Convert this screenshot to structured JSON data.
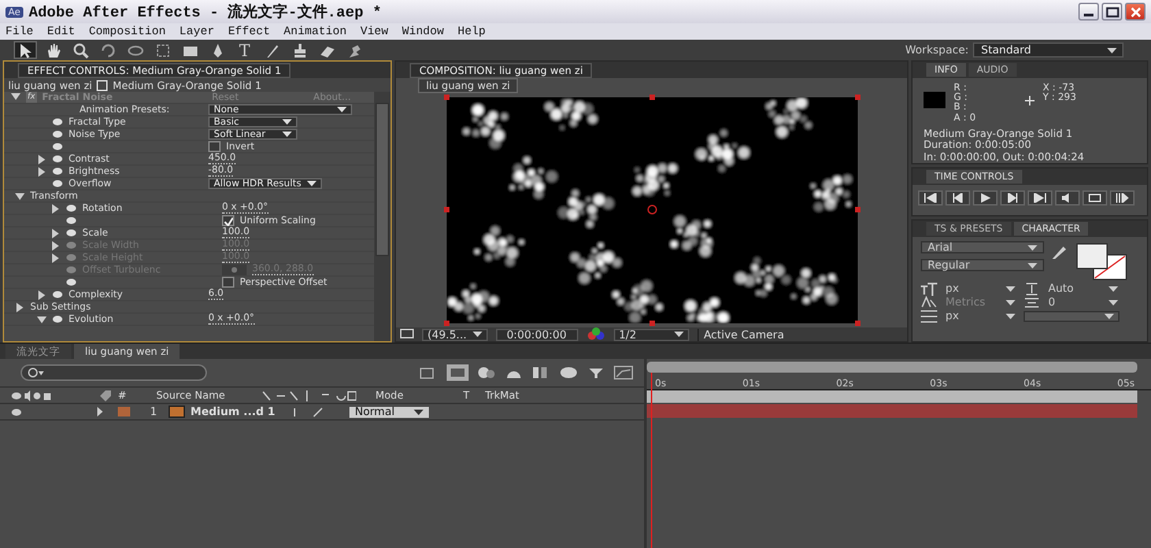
{
  "window": {
    "title": "Adobe After Effects - 流光文字-文件.aep *",
    "app_badge": "Ae"
  },
  "menu": [
    "File",
    "Edit",
    "Composition",
    "Layer",
    "Effect",
    "Animation",
    "View",
    "Window",
    "Help"
  ],
  "tools": [
    {
      "kind": "arrow",
      "selected": true
    },
    {
      "kind": "hand",
      "selected": false
    },
    {
      "kind": "zoom",
      "selected": false
    },
    {
      "kind": "rotate",
      "selected": false
    },
    {
      "kind": "orbit",
      "selected": false
    },
    {
      "kind": "pan",
      "selected": false
    },
    {
      "kind": "rect",
      "selected": false
    },
    {
      "kind": "pen",
      "selected": false
    },
    {
      "kind": "text",
      "glyph": "T",
      "selected": false
    },
    {
      "kind": "brush",
      "selected": false
    },
    {
      "kind": "stamp",
      "selected": false
    },
    {
      "kind": "eraser",
      "selected": false
    },
    {
      "kind": "pin",
      "selected": false
    }
  ],
  "workspace": {
    "label": "Workspace:",
    "value": "Standard"
  },
  "effect_controls": {
    "tab_title": "EFFECT CONTROLS: Medium Gray-Orange Solid 1",
    "comp": "liu guang wen zi",
    "layer": "Medium Gray-Orange Solid 1",
    "fx_badge": "fx",
    "effect_name": "Fractal Noise",
    "reset": "Reset",
    "about": "About...",
    "properties": [
      {
        "kind": "preset",
        "name": "Animation Presets:",
        "value": "None"
      },
      {
        "kind": "dropdown",
        "name": "Fractal Type",
        "value": "Basic"
      },
      {
        "kind": "dropdown",
        "name": "Noise Type",
        "value": "Soft Linear"
      },
      {
        "kind": "checkbox",
        "value": "Invert",
        "checked": false
      },
      {
        "kind": "number",
        "name": "Contrast",
        "value": "450.0",
        "expanded": false
      },
      {
        "kind": "number",
        "name": "Brightness",
        "value": "-80.0",
        "expanded": false
      },
      {
        "kind": "dropdown",
        "name": "Overflow",
        "value": "Allow HDR Results"
      },
      {
        "kind": "group",
        "name": "Transform",
        "expanded": true,
        "children": [
          {
            "kind": "number",
            "name": "Rotation",
            "value": "0 x +0.0°",
            "expanded": false
          },
          {
            "kind": "checkbox",
            "value": "Uniform Scaling",
            "checked": true
          },
          {
            "kind": "number",
            "name": "Scale",
            "value": "100.0",
            "expanded": false
          },
          {
            "kind": "number",
            "name": "Scale Width",
            "value": "100.0",
            "disabled": true,
            "expanded": false
          },
          {
            "kind": "number",
            "name": "Scale Height",
            "value": "100.0",
            "disabled": true,
            "expanded": false
          },
          {
            "kind": "point",
            "name": "Offset Turbulenc",
            "value": "360.0, 288.0",
            "disabled": true
          },
          {
            "kind": "checkbox",
            "value": "Perspective Offset",
            "checked": false
          }
        ]
      },
      {
        "kind": "number",
        "name": "Complexity",
        "value": "6.0",
        "expanded": false
      },
      {
        "kind": "group",
        "name": "Sub Settings",
        "expanded": false
      },
      {
        "kind": "number",
        "name": "Evolution",
        "value": "0 x +0.0°",
        "expanded": true
      }
    ]
  },
  "composition": {
    "tab_title": "COMPOSITION: liu guang wen zi",
    "view_tab": "liu guang wen zi",
    "zoom": "(49.5...",
    "timecode": "0:00:00:00",
    "resolution": "1/2",
    "camera": "Active Camera"
  },
  "info": {
    "tabs": [
      {
        "label": "INFO",
        "selected": true
      },
      {
        "label": "AUDIO",
        "selected": false
      }
    ],
    "r": "R :",
    "g": "G :",
    "b": "B :",
    "a": "A : 0",
    "x": "X : -73",
    "y": "Y : 293",
    "lines": [
      "Medium Gray-Orange Solid 1",
      "Duration: 0:00:05:00",
      "In: 0:00:00:00, Out: 0:00:04:24"
    ]
  },
  "time_controls": {
    "title": "TIME CONTROLS"
  },
  "character": {
    "tabs": [
      {
        "label": "TS & PRESETS",
        "selected": false
      },
      {
        "label": "CHARACTER",
        "selected": true
      }
    ],
    "font": "Arial",
    "style": "Regular",
    "size": "px",
    "leading": "Auto",
    "kerning": "Metrics",
    "tracking": "0",
    "stroke": "px"
  },
  "timeline": {
    "tabs": [
      {
        "label": "流光文字",
        "selected": false
      },
      {
        "label": "liu guang wen zi",
        "selected": true
      }
    ],
    "columns": [
      "#",
      "Source Name",
      "Mode",
      "T",
      "TrkMat"
    ],
    "layers": [
      {
        "number": "1",
        "name": "Medium ...d 1",
        "mode": "Normal",
        "color": "#b0643a"
      }
    ],
    "ruler": [
      "0s",
      "01s",
      "02s",
      "03s",
      "04s",
      "05s"
    ]
  }
}
